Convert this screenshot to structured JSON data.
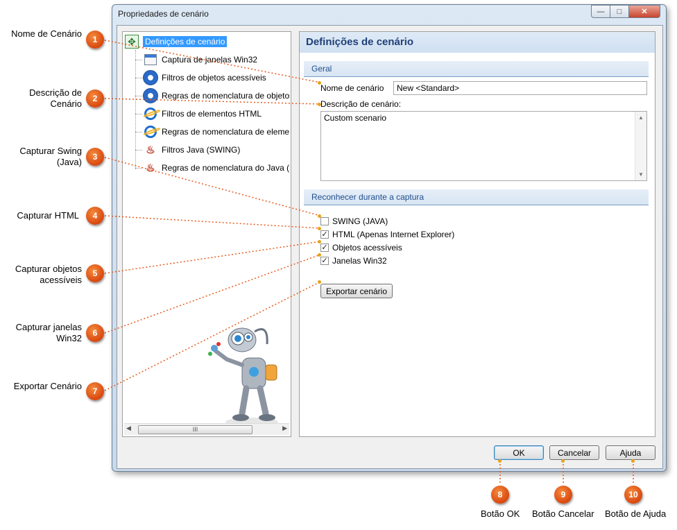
{
  "window": {
    "title": "Propriedades de cenário",
    "controls": {
      "minimize_icon": "—",
      "maximize_icon": "□",
      "close_icon": "✕"
    }
  },
  "tree": {
    "items": [
      {
        "label": "Definições de cenário",
        "icon": "scenario-settings-icon",
        "selected": true
      },
      {
        "label": "Captura de janelas Win32",
        "icon": "window-icon"
      },
      {
        "label": "Filtros de objetos acessíveis",
        "icon": "accessibility-icon"
      },
      {
        "label": "Regras de nomenclatura de objetos",
        "icon": "accessibility-icon"
      },
      {
        "label": "Filtros de elementos HTML",
        "icon": "internet-explorer-icon"
      },
      {
        "label": "Regras de nomenclatura de elementos",
        "icon": "internet-explorer-icon"
      },
      {
        "label": "Filtros Java (SWING)",
        "icon": "java-icon"
      },
      {
        "label": "Regras de nomenclatura do Java (SWING)",
        "icon": "java-icon"
      }
    ],
    "scrollbar_grip": "III"
  },
  "panel": {
    "title": "Definições de cenário",
    "section_general": "Geral",
    "name_label": "Nome de cenário",
    "name_value": "New <Standard>",
    "description_label": "Descrição de cenário:",
    "description_value": "Custom scenario",
    "section_recognize": "Reconhecer durante a captura",
    "checkboxes": [
      {
        "label": "SWING (JAVA)",
        "checked": false
      },
      {
        "label": "HTML (Apenas Internet Explorer)",
        "checked": true
      },
      {
        "label": "Objetos acessíveis",
        "checked": true
      },
      {
        "label": "Janelas Win32",
        "checked": true
      }
    ],
    "export_button": "Exportar cenário"
  },
  "buttons": {
    "ok": "OK",
    "cancel": "Cancelar",
    "help": "Ajuda"
  },
  "callouts": [
    {
      "number": "1",
      "label": "Nome de Cenário"
    },
    {
      "number": "2",
      "label": "Descrição de Cenário"
    },
    {
      "number": "3",
      "label": "Capturar Swing (Java)"
    },
    {
      "number": "4",
      "label": "Capturar HTML"
    },
    {
      "number": "5",
      "label": "Capturar objetos acessíveis"
    },
    {
      "number": "6",
      "label": "Capturar janelas Win32"
    },
    {
      "number": "7",
      "label": "Exportar Cenário"
    },
    {
      "number": "8",
      "label": "Botão OK"
    },
    {
      "number": "9",
      "label": "Botão Cancelar"
    },
    {
      "number": "10",
      "label": "Botão de Ajuda"
    }
  ],
  "colors": {
    "callout": "#e8591a",
    "connector": "#e8591a",
    "selection": "#3399ff",
    "header_text": "#1f3f77"
  }
}
